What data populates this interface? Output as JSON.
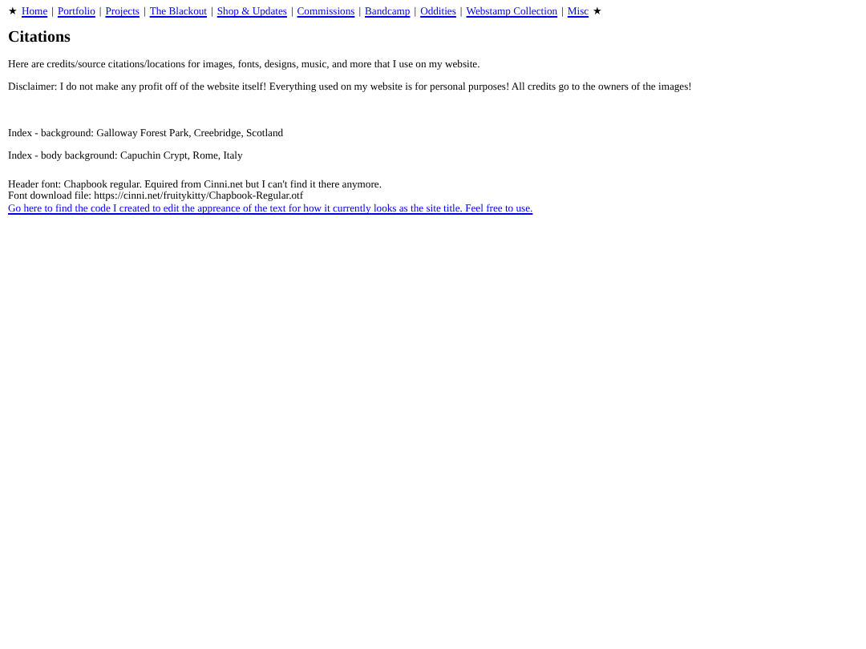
{
  "nav": {
    "lead": "★",
    "trail": "★",
    "separator": "|",
    "links": [
      "Home",
      "Portfolio",
      "Projects",
      "The Blackout",
      "Shop & Updates",
      "Commissions",
      "Bandcamp",
      "Oddities",
      "Webstamp Collection",
      "Misc"
    ]
  },
  "heading": "Citations",
  "intro": [
    "Here are credits/source citations/locations for images, fonts, designs, music, and more that I use on my website.",
    "Disclaimer: I do not make any profit off of the website itself! Everything used on my website is for personal purposes! All credits go to the owners of the images!"
  ],
  "credits": [
    "Index - background: Galloway Forest Park, Creebridge, Scotland",
    "Index - body background: Capuchin Crypt, Rome, Italy"
  ],
  "font_block": {
    "lines": [
      "Header font: Chapbook regular. Equired from Cinni.net but I can't find it there anymore.",
      "Font download file: https://cinni.net/fruitykitty/Chapbook-Regular.otf"
    ],
    "link": "Go here to find the code I created to edit the appreance of the text for how it currently looks as the site title. Feel free to use."
  }
}
